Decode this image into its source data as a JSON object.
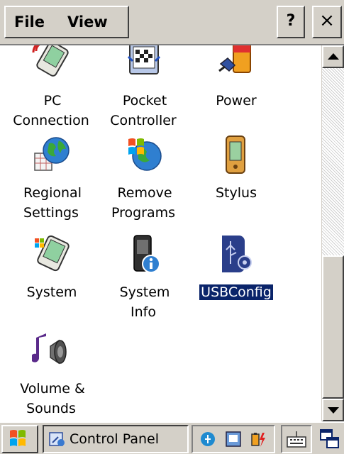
{
  "menu": {
    "file": "File",
    "view": "View",
    "help": "?",
    "close": "×"
  },
  "items": [
    {
      "label": "PC\nConnection",
      "icon": "pc-connection-icon"
    },
    {
      "label": "Pocket\nController",
      "icon": "pocket-controller-icon"
    },
    {
      "label": "Power",
      "icon": "power-icon"
    },
    {
      "label": "Regional\nSettings",
      "icon": "regional-settings-icon"
    },
    {
      "label": "Remove\nPrograms",
      "icon": "remove-programs-icon"
    },
    {
      "label": "Stylus",
      "icon": "stylus-icon"
    },
    {
      "label": "System",
      "icon": "system-icon"
    },
    {
      "label": "System\nInfo",
      "icon": "system-info-icon"
    },
    {
      "label": "USBConfig",
      "icon": "usbconfig-icon",
      "selected": true
    },
    {
      "label": "Volume &\nSounds",
      "icon": "volume-sounds-icon"
    }
  ],
  "taskbar": {
    "active_task": "Control Panel"
  },
  "colors": {
    "chrome": "#d4d0c8",
    "selection": "#0a246a",
    "background": "#ffffff"
  }
}
